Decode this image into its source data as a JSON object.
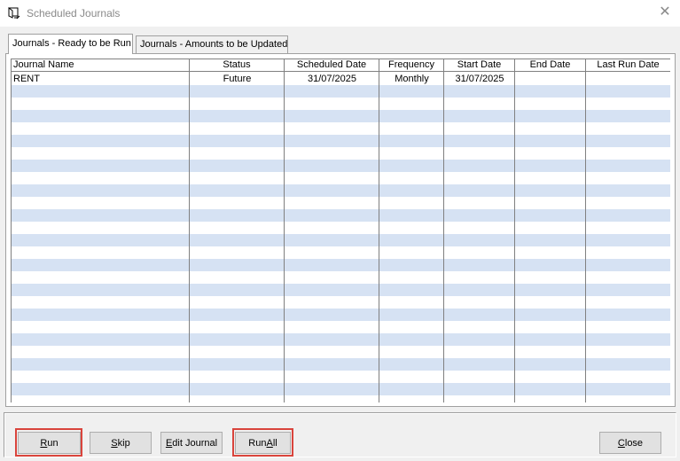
{
  "window": {
    "title": "Scheduled Journals",
    "close_glyph": "✕"
  },
  "tabs": [
    {
      "label": "Journals - Ready to be Run",
      "active": true
    },
    {
      "label": "Journals - Amounts to be Updated",
      "active": false
    }
  ],
  "table": {
    "columns": [
      "Journal Name",
      "Status",
      "Scheduled Date",
      "Frequency",
      "Start Date",
      "End Date",
      "Last Run Date"
    ],
    "rows": [
      [
        "RENT",
        "Future",
        "31/07/2025",
        "Monthly",
        "31/07/2025",
        "",
        ""
      ]
    ],
    "row_stripe_color": "#d6e2f3"
  },
  "buttons": {
    "run": {
      "accel": "R",
      "rest": "un"
    },
    "skip": {
      "accel": "S",
      "rest": "kip"
    },
    "edit_journal": {
      "accel": "E",
      "rest": "dit Journal"
    },
    "run_all": {
      "pre": "Run ",
      "accel": "A",
      "rest": "ll"
    },
    "close": {
      "accel": "C",
      "rest": "lose"
    }
  },
  "highlight_color": "#d9443c"
}
